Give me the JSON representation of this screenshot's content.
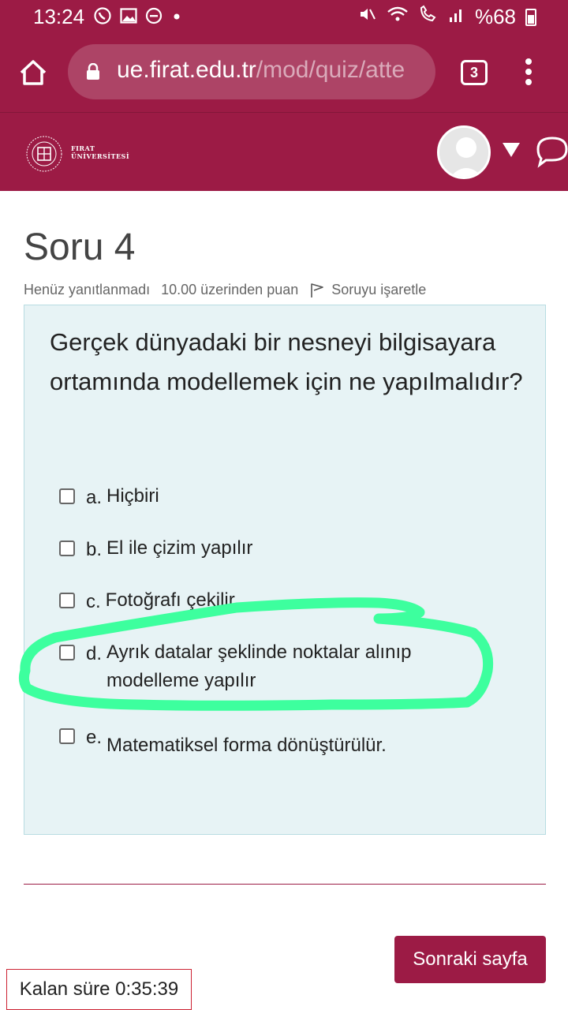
{
  "status_bar": {
    "time": "13:24",
    "battery_text": "%68",
    "icons_left": [
      "whatsapp-icon",
      "gallery-icon",
      "dnd-icon",
      "dot-icon"
    ],
    "icons_right": [
      "mute-icon",
      "wifi-icon",
      "call-wifi-icon",
      "signal-icon",
      "battery-icon"
    ]
  },
  "browser": {
    "url_host": "ue.firat.edu.tr",
    "url_path": "/mod/quiz/atte",
    "tab_count": "3"
  },
  "header": {
    "logo_line1": "FIRAT",
    "logo_line2": "ÜNİVERSİTESİ"
  },
  "page": {
    "title": "Soru 4",
    "status": "Henüz yanıtlanmadı",
    "marks": "10.00 üzerinden puan",
    "flag_label": "Soruyu işaretle"
  },
  "question": {
    "text": "Gerçek dünyadaki bir nesneyi bilgisayara ortamında modellemek için ne yapılmalıdır?",
    "options": [
      {
        "letter": "a.",
        "label": "Hiçbiri"
      },
      {
        "letter": "b.",
        "label": "El ile çizim yapılır"
      },
      {
        "letter": "c.",
        "label": "Fotoğrafı çekilir."
      },
      {
        "letter": "d.",
        "label": "Ayrık datalar şeklinde noktalar alınıp",
        "label2": "modelleme yapılır"
      },
      {
        "letter": "e.",
        "label": "Matematiksel forma dönüştürülür."
      }
    ]
  },
  "footer": {
    "next_label": "Sonraki sayfa",
    "timer": "Kalan süre 0:35:39"
  },
  "colors": {
    "brand": "#9c1b45",
    "question_bg": "#e7f3f5",
    "highlight": "#3dff9e"
  }
}
